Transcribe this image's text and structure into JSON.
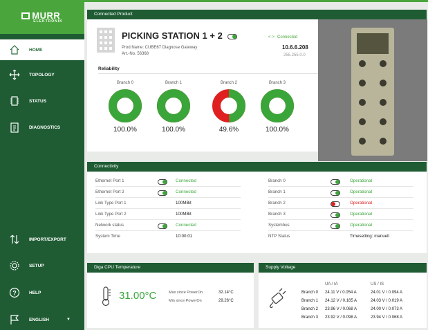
{
  "brand": {
    "logo_text": "MURR",
    "logo_sub": "ELEKTRONIK"
  },
  "nav": [
    {
      "label": "HOME",
      "icon": "home-icon",
      "active": true
    },
    {
      "label": "TOPOLOGY",
      "icon": "topology-icon"
    },
    {
      "label": "STATUS",
      "icon": "status-icon"
    },
    {
      "label": "DIAGNOSTICS",
      "icon": "clipboard-icon"
    },
    {
      "label": "IMPORT/EXPORT",
      "icon": "import-export-icon"
    },
    {
      "label": "SETUP",
      "icon": "gear-icon"
    },
    {
      "label": "HELP",
      "icon": "help-icon"
    },
    {
      "label": "ENGLISH",
      "icon": "flag-icon",
      "caret": "▼"
    }
  ],
  "product": {
    "header": "Connected Product",
    "title": "PICKING STATION 1 + 2",
    "prod_name": "Prod.Name: CUBE67 Diagnose Gateway",
    "art_no": "Art.-No. 56368",
    "conn_status": "Connected",
    "ip": "10.6.6.208",
    "mask": "255.255.0.0",
    "reliability_title": "Reliability",
    "branches": [
      {
        "label": "Branch 0",
        "value": 100.0,
        "pct": "100.0%"
      },
      {
        "label": "Branch 1",
        "value": 100.0,
        "pct": "100.0%"
      },
      {
        "label": "Branch 2",
        "value": 49.6,
        "pct": "49.6%"
      },
      {
        "label": "Branch 3",
        "value": 100.0,
        "pct": "100.0%"
      }
    ]
  },
  "connectivity": {
    "header": "Connectivity",
    "left": [
      {
        "key": "Ethernet Port 1",
        "toggle": true,
        "value": "Connected",
        "status": "green"
      },
      {
        "key": "Ethernet Port 2",
        "toggle": true,
        "value": "Connected",
        "status": "green"
      },
      {
        "key": "Link Type Port 1",
        "toggle": false,
        "value": "100MBit",
        "status": "plain"
      },
      {
        "key": "Link Type Port 2",
        "toggle": false,
        "value": "100MBit",
        "status": "plain"
      },
      {
        "key": "Network status",
        "toggle": true,
        "value": "Connected",
        "status": "green"
      },
      {
        "key": "System Time",
        "toggle": false,
        "value": "10:00:01",
        "status": "plain"
      }
    ],
    "right": [
      {
        "key": "Branch 0",
        "toggle": true,
        "value": "Operational",
        "status": "green"
      },
      {
        "key": "Branch 1",
        "toggle": true,
        "value": "Operational",
        "status": "green"
      },
      {
        "key": "Branch 2",
        "toggle": true,
        "value": "Operational",
        "status": "red"
      },
      {
        "key": "Branch 3",
        "toggle": true,
        "value": "Operational",
        "status": "green"
      },
      {
        "key": "Systembus",
        "toggle": true,
        "value": "Operational",
        "status": "green"
      },
      {
        "key": "NTP Status",
        "toggle": false,
        "value": "Timesetting: manuell",
        "status": "plain"
      }
    ]
  },
  "cpu": {
    "header": "Diga CPU Temperature",
    "temp": "31.00°C",
    "max_label": "Max since PowerOn",
    "max_value": "32.14°C",
    "min_label": "Min since PowerOn",
    "min_value": "29.26°C"
  },
  "supply": {
    "header": "Supply Voltage",
    "col1": "UA / IA",
    "col2": "US / IS",
    "rows": [
      {
        "branch": "Branch 0",
        "ua": "24.11 V / 0.054 A",
        "us": "24.01 V / 0.094 A"
      },
      {
        "branch": "Branch 1",
        "ua": "24.12 V / 0.165 A",
        "us": "24.03 V / 0.019 A"
      },
      {
        "branch": "Branch 2",
        "ua": "23.96 V / 0.068 A",
        "us": "24.00 V / 0.073 A"
      },
      {
        "branch": "Branch 3",
        "ua": "23.92 V / 0.098 A",
        "us": "23.94 V / 0.068 A"
      }
    ]
  },
  "colors": {
    "brand_green": "#1f5c34",
    "accent_green": "#4aa63c",
    "ok": "#3aa63a",
    "error": "#e02020"
  }
}
